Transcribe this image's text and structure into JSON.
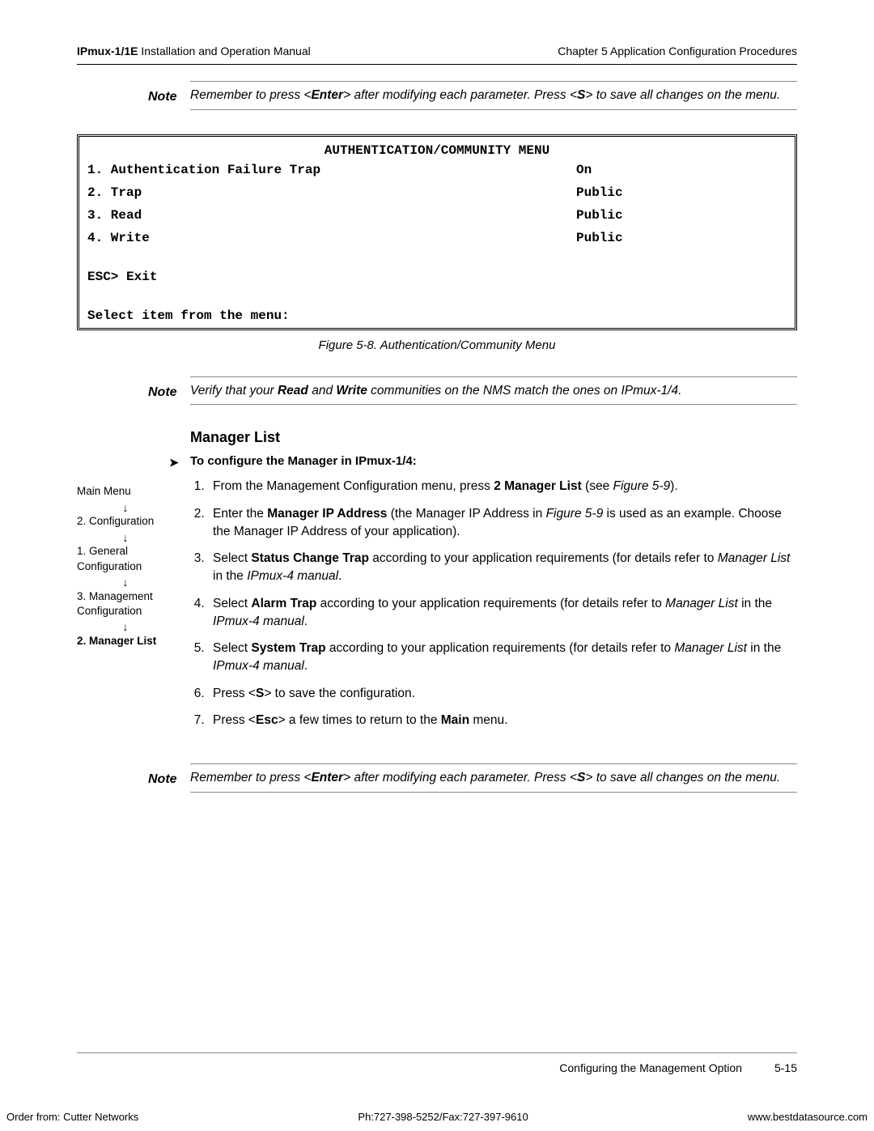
{
  "header": {
    "left_bold": "IPmux-1/1E",
    "left_rest": " Installation and Operation Manual",
    "right": "Chapter 5  Application Configuration Procedures"
  },
  "note1": {
    "label": "Note",
    "text_pre": "Remember to press <",
    "text_enter": "Enter",
    "text_mid": "> after modifying each parameter. Press <",
    "text_s": "S",
    "text_post": "> to save all changes on the menu."
  },
  "menu": {
    "title": "AUTHENTICATION/COMMUNITY MENU",
    "rows": [
      {
        "label": "1. Authentication Failure Trap",
        "value": "On"
      },
      {
        "label": "2. Trap",
        "value": "Public"
      },
      {
        "label": "3. Read",
        "value": "Public"
      },
      {
        "label": "4. Write",
        "value": "Public"
      }
    ],
    "esc": "ESC> Exit",
    "prompt": "Select item from the menu:"
  },
  "figure_caption": "Figure 5-8.  Authentication/Community Menu",
  "note2": {
    "label": "Note",
    "text_pre": "Verify that your ",
    "read": "Read",
    "text_and": " and ",
    "write": "Write",
    "text_post": " communities on the NMS match the ones on IPmux-1/4."
  },
  "section_heading": "Manager List",
  "proc_heading": "To configure the Manager in IPmux-1/4:",
  "sidebar": {
    "main": "Main Menu",
    "item2": "2. Configuration",
    "item1": "1. General Configuration",
    "item3": "3. Management Configuration",
    "manager": "2. Manager List"
  },
  "steps": {
    "s1_a": "From the Management Configuration menu, press ",
    "s1_b": "2 Manager List",
    "s1_c": "  (see ",
    "s1_d": "Figure 5-9",
    "s1_e": ").",
    "s2_a": "Enter the ",
    "s2_b": "Manager IP Address",
    "s2_c": " (the Manager IP Address in ",
    "s2_d": "Figure 5-9",
    "s2_e": " is used as an example. Choose the Manager IP Address of your application).",
    "s3_a": "Select ",
    "s3_b": "Status Change Trap",
    "s3_c": " according to your application requirements (for details refer to ",
    "s3_d": "Manager List",
    "s3_e": " in the ",
    "s3_f": "IPmux-4 manual",
    "s3_g": ".",
    "s4_a": "Select ",
    "s4_b": "Alarm Trap",
    "s4_c": " according to your application requirements (for details refer to ",
    "s4_d": "Manager List",
    "s4_e": " in the ",
    "s4_f": "IPmux-4 manual",
    "s4_g": ".",
    "s5_a": "Select ",
    "s5_b": "System Trap",
    "s5_c": " according to your application requirements (for details refer to ",
    "s5_d": "Manager List",
    "s5_e": " in the ",
    "s5_f": "IPmux-4 manual",
    "s5_g": ".",
    "s6_a": "Press <",
    "s6_b": "S",
    "s6_c": "> to save the configuration.",
    "s7_a": "Press <",
    "s7_b": "Esc",
    "s7_c": "> a few times to return to the ",
    "s7_d": "Main",
    "s7_e": " menu."
  },
  "note3": {
    "label": "Note",
    "text_pre": "Remember to press <",
    "text_enter": "Enter",
    "text_mid": "> after modifying each parameter. Press <",
    "text_s": "S",
    "text_post": "> to save all changes on the menu."
  },
  "footer": {
    "section": "Configuring the Management Option",
    "page": "5-15"
  },
  "bottom": {
    "left": "Order from: Cutter Networks",
    "center": "Ph:727-398-5252/Fax:727-397-9610",
    "right": "www.bestdatasource.com"
  }
}
